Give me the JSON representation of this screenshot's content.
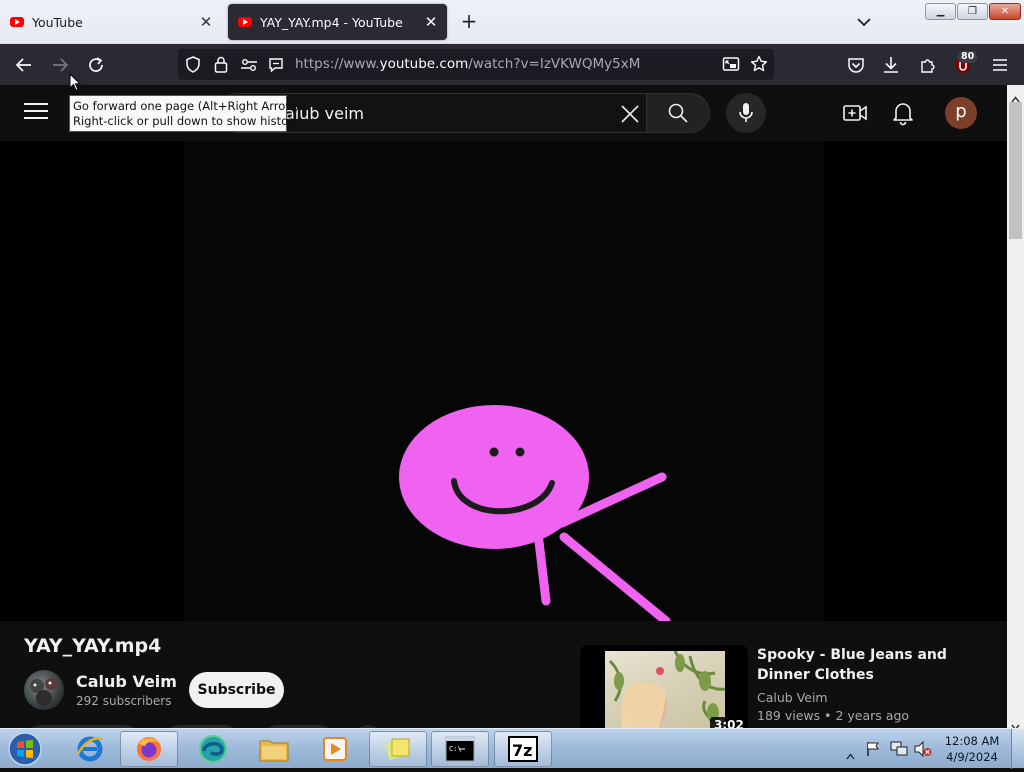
{
  "browser": {
    "tabs": [
      {
        "title": "YouTube",
        "active": false
      },
      {
        "title": "YAY_YAY.mp4 - YouTube",
        "active": true
      }
    ],
    "url": {
      "scheme_prefix": "https://www.",
      "host": "youtube.com",
      "path": "/watch?v=IzVKWQMy5xM"
    },
    "extension_badge": "80",
    "tooltip": {
      "line1": "Go forward one page (Alt+Right Arrow)",
      "line2": "Right-click or pull down to show history"
    }
  },
  "youtube": {
    "search": {
      "query": "calub veim",
      "visible_query": "alub veim"
    },
    "avatar_letter": "p",
    "video": {
      "title": "YAY_YAY.mp4"
    },
    "channel": {
      "name": "Calub Veim",
      "subscribers": "292 subscribers",
      "subscribe_label": "Subscribe"
    },
    "recommended": [
      {
        "title": "Spooky - Blue Jeans and Dinner Clothes",
        "channel": "Calub Veim",
        "views": "189 views",
        "age": "2 years ago",
        "duration": "3:02"
      }
    ]
  },
  "taskbar": {
    "apps": [
      "start-orb",
      "internet-explorer-icon",
      "firefox-icon",
      "edge-icon",
      "file-explorer-icon",
      "media-player-icon",
      "sticky-notes-icon",
      "command-prompt-icon",
      "7zip-icon"
    ],
    "clock": {
      "time": "12:08 AM",
      "date": "4/9/2024"
    }
  },
  "colors": {
    "yt_bg": "#0f0f0f",
    "firefox_toolbar": "#2b2a33",
    "smiley_pink": "#f062f0",
    "yt_red": "#ff0000"
  }
}
